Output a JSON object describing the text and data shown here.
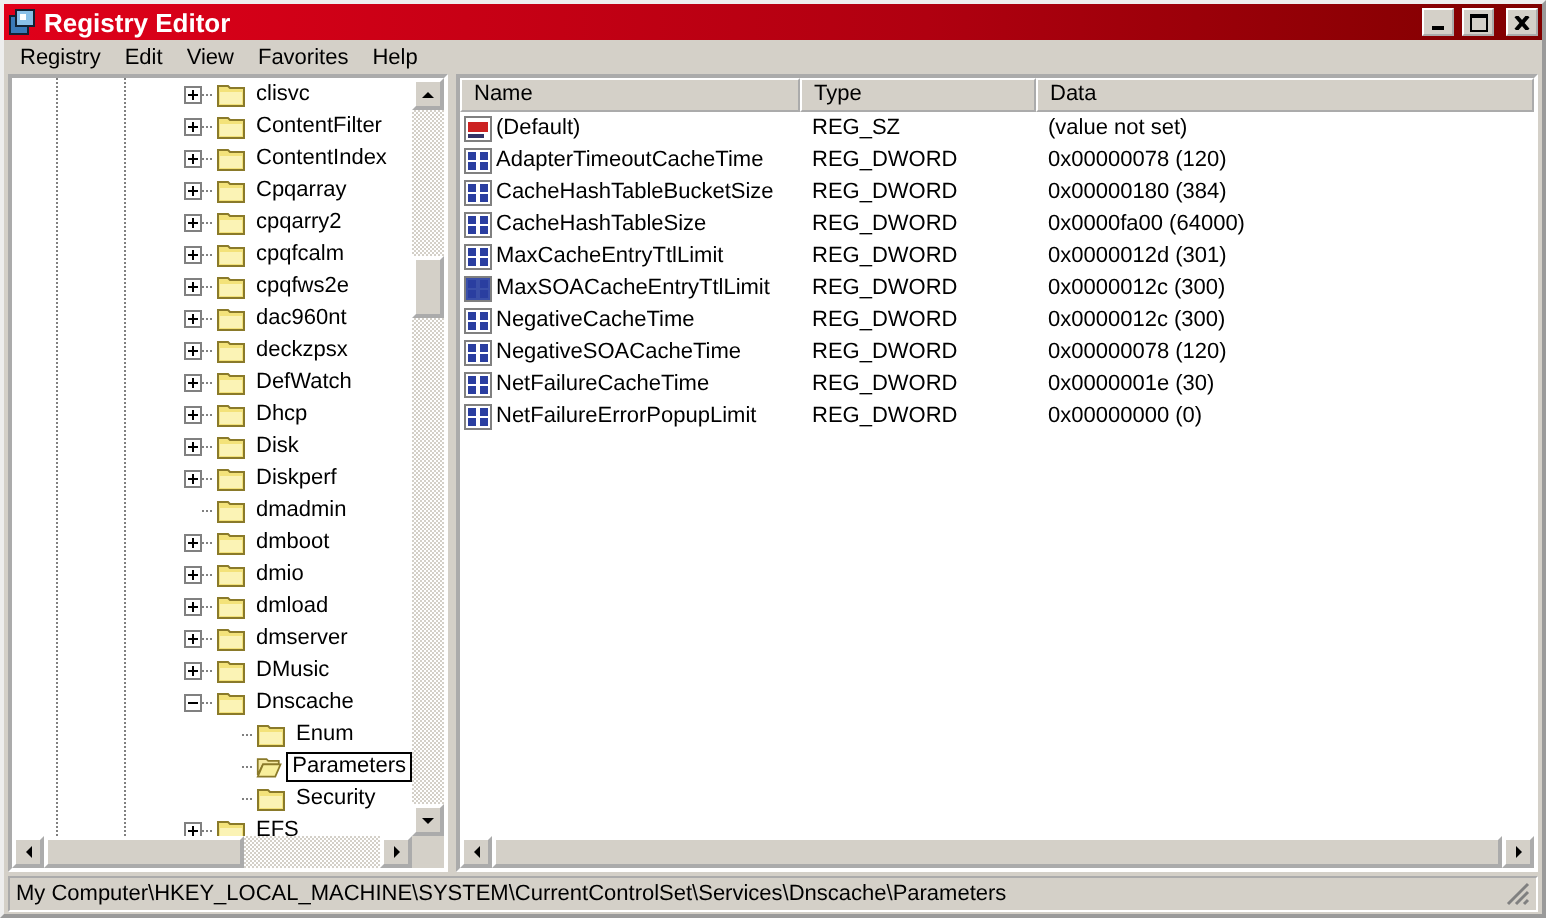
{
  "window": {
    "title": "Registry Editor"
  },
  "menu": [
    "Registry",
    "Edit",
    "View",
    "Favorites",
    "Help"
  ],
  "tree": {
    "items": [
      {
        "label": "clisvc",
        "expandable": true,
        "expanded": false,
        "selected": false
      },
      {
        "label": "ContentFilter",
        "expandable": true,
        "expanded": false,
        "selected": false
      },
      {
        "label": "ContentIndex",
        "expandable": true,
        "expanded": false,
        "selected": false
      },
      {
        "label": "Cpqarray",
        "expandable": true,
        "expanded": false,
        "selected": false
      },
      {
        "label": "cpqarry2",
        "expandable": true,
        "expanded": false,
        "selected": false
      },
      {
        "label": "cpqfcalm",
        "expandable": true,
        "expanded": false,
        "selected": false
      },
      {
        "label": "cpqfws2e",
        "expandable": true,
        "expanded": false,
        "selected": false
      },
      {
        "label": "dac960nt",
        "expandable": true,
        "expanded": false,
        "selected": false
      },
      {
        "label": "deckzpsx",
        "expandable": true,
        "expanded": false,
        "selected": false
      },
      {
        "label": "DefWatch",
        "expandable": true,
        "expanded": false,
        "selected": false
      },
      {
        "label": "Dhcp",
        "expandable": true,
        "expanded": false,
        "selected": false
      },
      {
        "label": "Disk",
        "expandable": true,
        "expanded": false,
        "selected": false
      },
      {
        "label": "Diskperf",
        "expandable": true,
        "expanded": false,
        "selected": false
      },
      {
        "label": "dmadmin",
        "expandable": false,
        "selected": false
      },
      {
        "label": "dmboot",
        "expandable": true,
        "expanded": false,
        "selected": false
      },
      {
        "label": "dmio",
        "expandable": true,
        "expanded": false,
        "selected": false
      },
      {
        "label": "dmload",
        "expandable": true,
        "expanded": false,
        "selected": false
      },
      {
        "label": "dmserver",
        "expandable": true,
        "expanded": false,
        "selected": false
      },
      {
        "label": "DMusic",
        "expandable": true,
        "expanded": false,
        "selected": false
      },
      {
        "label": "Dnscache",
        "expandable": true,
        "expanded": true,
        "selected": false,
        "children": [
          {
            "label": "Enum",
            "expandable": false,
            "selected": false
          },
          {
            "label": "Parameters",
            "expandable": false,
            "selected": true
          },
          {
            "label": "Security",
            "expandable": false,
            "selected": false
          }
        ]
      },
      {
        "label": "EFS",
        "expandable": true,
        "expanded": false,
        "selected": false
      }
    ]
  },
  "values": {
    "columns": [
      "Name",
      "Type",
      "Data"
    ],
    "rows": [
      {
        "kind": "string",
        "name": "(Default)",
        "type": "REG_SZ",
        "data": "(value not set)",
        "selected": false
      },
      {
        "kind": "binary",
        "name": "AdapterTimeoutCacheTime",
        "type": "REG_DWORD",
        "data": "0x00000078 (120)",
        "selected": false
      },
      {
        "kind": "binary",
        "name": "CacheHashTableBucketSize",
        "type": "REG_DWORD",
        "data": "0x00000180 (384)",
        "selected": false
      },
      {
        "kind": "binary",
        "name": "CacheHashTableSize",
        "type": "REG_DWORD",
        "data": "0x0000fa00 (64000)",
        "selected": false
      },
      {
        "kind": "binary",
        "name": "MaxCacheEntryTtlLimit",
        "type": "REG_DWORD",
        "data": "0x0000012d (301)",
        "selected": false
      },
      {
        "kind": "binary",
        "name": "MaxSOACacheEntryTtlLimit",
        "type": "REG_DWORD",
        "data": "0x0000012c (300)",
        "selected": true
      },
      {
        "kind": "binary",
        "name": "NegativeCacheTime",
        "type": "REG_DWORD",
        "data": "0x0000012c (300)",
        "selected": false
      },
      {
        "kind": "binary",
        "name": "NegativeSOACacheTime",
        "type": "REG_DWORD",
        "data": "0x00000078 (120)",
        "selected": false
      },
      {
        "kind": "binary",
        "name": "NetFailureCacheTime",
        "type": "REG_DWORD",
        "data": "0x0000001e (30)",
        "selected": false
      },
      {
        "kind": "binary",
        "name": "NetFailureErrorPopupLimit",
        "type": "REG_DWORD",
        "data": "0x00000000 (0)",
        "selected": false
      }
    ]
  },
  "status_bar": "My Computer\\HKEY_LOCAL_MACHINE\\SYSTEM\\CurrentControlSet\\Services\\Dnscache\\Parameters"
}
